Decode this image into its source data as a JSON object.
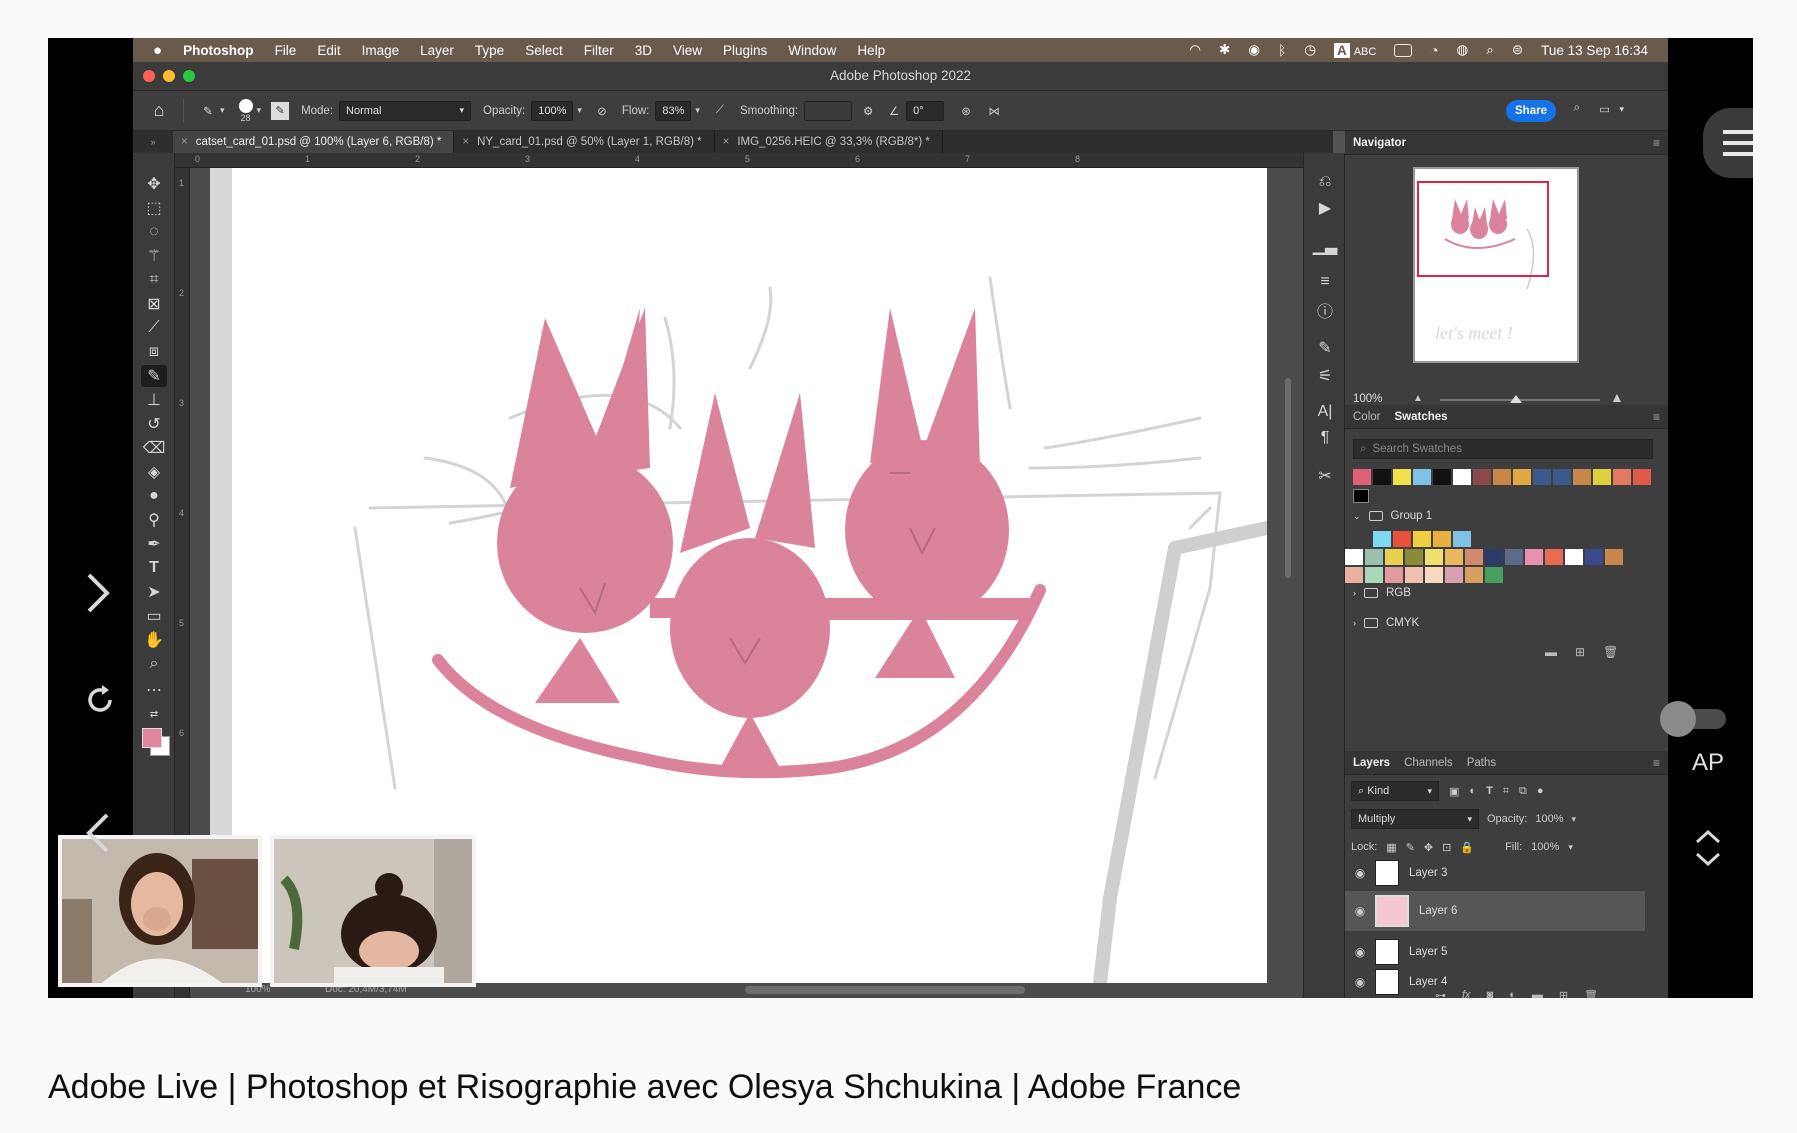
{
  "menubar": {
    "app": "Photoshop",
    "items": [
      "File",
      "Edit",
      "Image",
      "Layer",
      "Type",
      "Select",
      "Filter",
      "3D",
      "View",
      "Plugins",
      "Window",
      "Help"
    ],
    "input_label": "ABC",
    "datetime": "Tue 13 Sep  16:34"
  },
  "window": {
    "title": "Adobe Photoshop 2022"
  },
  "options": {
    "brush_size": "28",
    "mode_label": "Mode:",
    "mode_value": "Normal",
    "opacity_label": "Opacity:",
    "opacity_value": "100%",
    "flow_label": "Flow:",
    "flow_value": "83%",
    "smoothing_label": "Smoothing:",
    "angle_value": "0°",
    "share_label": "Share"
  },
  "tabs": [
    {
      "label": "catset_card_01.psd @ 100% (Layer 6, RGB/8) *",
      "active": true
    },
    {
      "label": "NY_card_01.psd @ 50% (Layer 1, RGB/8) *",
      "active": false
    },
    {
      "label": "IMG_0256.HEIC @ 33,3% (RGB/8*) *",
      "active": false
    }
  ],
  "rulers": {
    "top": [
      "0",
      "1",
      "2",
      "3",
      "4",
      "5",
      "6",
      "7",
      "8"
    ],
    "left": [
      "1",
      "2",
      "3",
      "4",
      "5",
      "6"
    ]
  },
  "navigator": {
    "title": "Navigator",
    "zoom": "100%",
    "thumb_text": "let's meet !"
  },
  "color_panel": {
    "tabs": [
      "Color",
      "Swatches"
    ],
    "search_placeholder": "Search Swatches",
    "groups": [
      "Group 1",
      "RGB",
      "CMYK"
    ],
    "row1": [
      "#e0607a",
      "#111111",
      "#f0e04a",
      "#7ec3e6",
      "#111111",
      "#ffffff",
      "#8a4a4a",
      "#c8884a",
      "#e0a840",
      "#3a5a8a",
      "#3a5a8a",
      "#c8884a",
      "#e0d040",
      "#e07a60",
      "#e05a4a"
    ],
    "group1_a": [
      "#7ed8f0",
      "#e8503a",
      "#f0d040",
      "#e8b040",
      "#7ec3e6"
    ],
    "group1_b": [
      "#ffffff",
      "#9ac0b0",
      "#e8d050",
      "#8a8a3a",
      "#f0e070",
      "#e8b860",
      "#d08a70",
      "#2a3a6a",
      "#5a6a8a",
      "#e890b0",
      "#e86a50",
      "#ffffff",
      "#3a4a8a",
      "#c8884a"
    ],
    "group1_c": [
      "#e8b0a0",
      "#a8d8b8",
      "#e09aa0",
      "#f0c0b0",
      "#f8d8c0",
      "#d8a0b0",
      "#d8a060",
      "#48a060"
    ]
  },
  "layers_panel": {
    "tabs": [
      "Layers",
      "Channels",
      "Paths"
    ],
    "kind_label": "Kind",
    "blend_mode": "Multiply",
    "opacity_label": "Opacity:",
    "opacity_value": "100%",
    "lock_label": "Lock:",
    "fill_label": "Fill:",
    "fill_value": "100%",
    "layers": [
      {
        "name": "Layer 3",
        "selected": false
      },
      {
        "name": "Layer 6",
        "selected": true
      },
      {
        "name": "Layer 5",
        "selected": false
      },
      {
        "name": "Layer 4",
        "selected": false
      }
    ]
  },
  "status": {
    "zoom": "100%",
    "doc": "Doc: 20,4M/3,74M"
  },
  "overlay": {
    "ap_label": "AP"
  },
  "video_title": "Adobe Live | Photoshop et Risographie avec Olesya Shchukina | Adobe France"
}
